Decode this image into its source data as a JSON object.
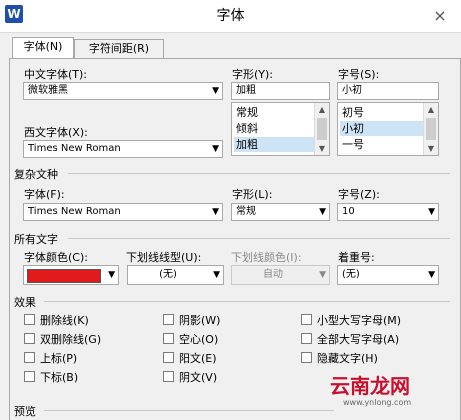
{
  "window": {
    "title": "字体",
    "app_icon": "W",
    "close_glyph": "×"
  },
  "tabs": [
    {
      "label": "字体(N)",
      "active": true
    },
    {
      "label": "字符间距(R)",
      "active": false
    }
  ],
  "chinese_font": {
    "label": "中文字体(T):",
    "value": "微软雅黑"
  },
  "western_font": {
    "label": "西文字体(X):",
    "value": "Times New Roman"
  },
  "font_style": {
    "label": "字形(Y):",
    "value": "加粗",
    "options": [
      "常规",
      "倾斜",
      "加粗"
    ],
    "selected_index": 2
  },
  "font_size": {
    "label": "字号(S):",
    "value": "小初",
    "options": [
      "初号",
      "小初",
      "一号"
    ],
    "selected_index": 1
  },
  "complex_section": {
    "title": "复杂文种",
    "font": {
      "label": "字体(F):",
      "value": "Times New Roman"
    },
    "style": {
      "label": "字形(L):",
      "value": "常规"
    },
    "size": {
      "label": "字号(Z):",
      "value": "10"
    }
  },
  "all_text_section": {
    "title": "所有文字",
    "font_color": {
      "label": "字体颜色(C):",
      "color": "#e01b1b"
    },
    "underline_style": {
      "label": "下划线线型(U):",
      "value": "(无)"
    },
    "underline_color": {
      "label": "下划线颜色(I):",
      "value": "自动"
    },
    "emphasis": {
      "label": "着重号:",
      "value": "(无)"
    }
  },
  "effects_section": {
    "title": "效果",
    "col1": [
      "删除线(K)",
      "双删除线(G)",
      "上标(P)",
      "下标(B)"
    ],
    "col2": [
      "阴影(W)",
      "空心(O)",
      "阳文(E)",
      "阴文(V)"
    ],
    "col3": [
      "小型大写字母(M)",
      "全部大写字母(A)",
      "隐藏文字(H)"
    ]
  },
  "preview_section": {
    "title": "预览"
  },
  "watermark": {
    "text": "云南龙网",
    "sub": "www.ynlong.com"
  },
  "colors": {
    "accent_selection": "#cde4f7",
    "brand": "#1f4fa8"
  }
}
